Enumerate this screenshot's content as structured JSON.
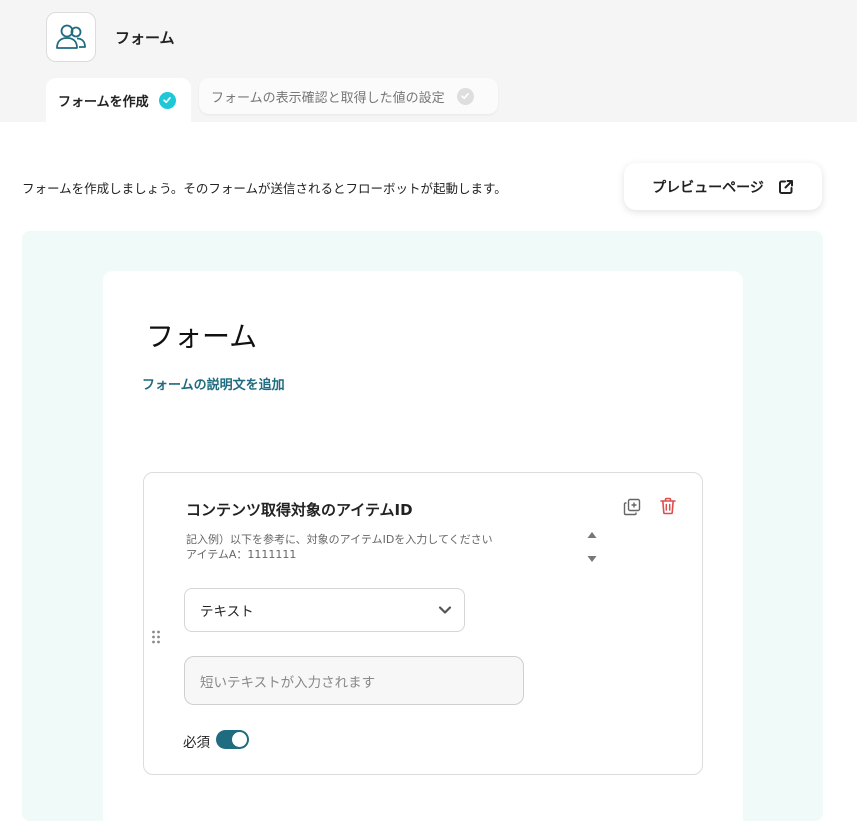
{
  "header": {
    "app_icon": "users-icon",
    "title": "フォーム",
    "steps": [
      {
        "label": "フォームを作成",
        "status": "complete"
      },
      {
        "label": "フォームの表示確認と取得した値の設定",
        "status": "pending"
      }
    ]
  },
  "intro": {
    "text": "フォームを作成しましょう。そのフォームが送信されるとフローボットが起動します。",
    "preview_button": {
      "label": "プレビューページ",
      "icon": "external-link-icon"
    }
  },
  "form": {
    "title": "フォーム",
    "add_description": "フォームの説明文を追加",
    "question": {
      "title": "コンテンツ取得対象のアイテムID",
      "help_lines": [
        "記入例）以下を参考に、対象のアイテムIDを入力してください",
        "アイテムA：1111111"
      ],
      "type_value": "テキスト",
      "input_placeholder": "短いテキストが入力されます",
      "required_label": "必須",
      "required": true
    }
  },
  "colors": {
    "accent": "#1f6b80",
    "check": "#1ec8d8",
    "delete": "#e04b4b",
    "canvas": "#f0faf8"
  }
}
